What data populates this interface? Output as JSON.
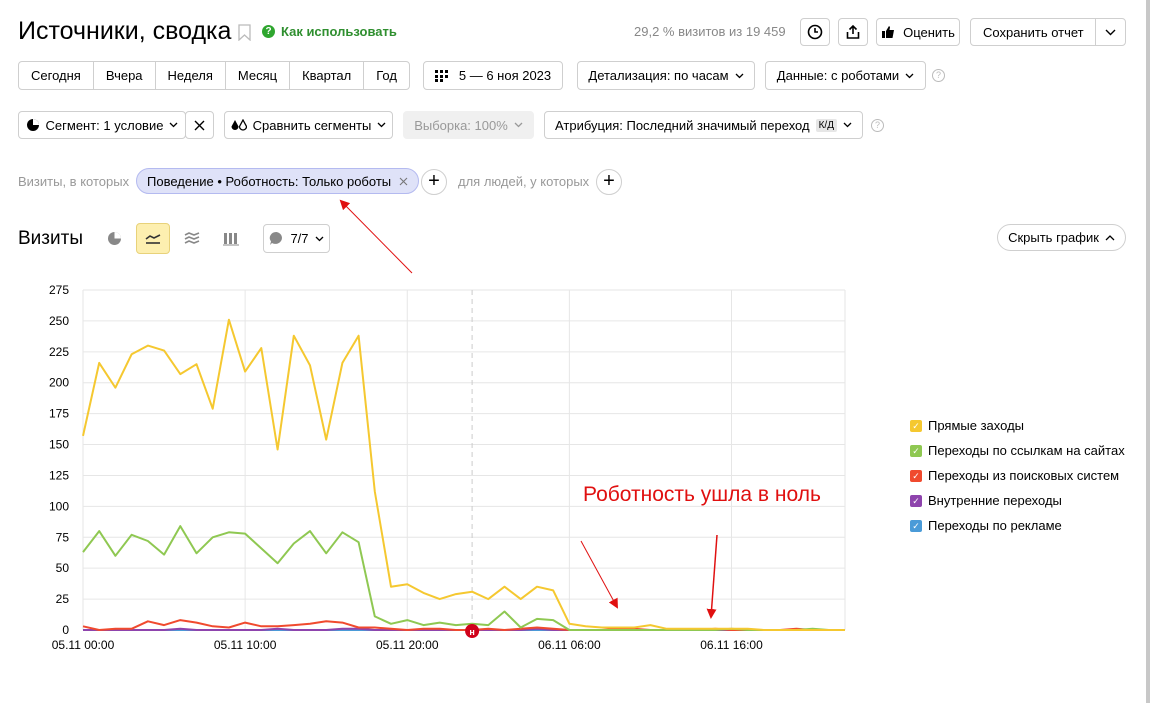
{
  "header": {
    "title": "Источники, сводка",
    "how_to_use": "Как использовать",
    "visits_info": "29,2 % визитов из 19 459",
    "rate_label": "Оценить",
    "save_report_label": "Сохранить отчет"
  },
  "periods": [
    "Сегодня",
    "Вчера",
    "Неделя",
    "Месяц",
    "Квартал",
    "Год"
  ],
  "date_range": "5 — 6 ноя 2023",
  "detail": "Детализация: по часам",
  "data_mode": "Данные: с роботами",
  "segment": "Сегмент: 1 условие",
  "compare": "Сравнить сегменты",
  "sample": "Выборка: 100%",
  "attribution": "Атрибуция: Последний значимый переход",
  "attribution_badge": "К/Д",
  "filter": {
    "prefix": "Визиты, в которых",
    "chip": "Поведение • Роботность: Только роботы",
    "people": "для людей, у которых"
  },
  "visits_section": {
    "title": "Визиты",
    "metrics_count": "7/7",
    "hide_chart": "Скрыть график"
  },
  "annotation": "Роботность ушла в ноль",
  "marker_label": "н",
  "chart_data": {
    "type": "line",
    "ylim": [
      0,
      275
    ],
    "yticks": [
      0,
      25,
      50,
      75,
      100,
      125,
      150,
      175,
      200,
      225,
      250,
      275
    ],
    "xtick_labels": [
      "05.11 00:00",
      "05.11 10:00",
      "05.11 20:00",
      "06.11 06:00",
      "06.11 16:00"
    ],
    "xtick_hours": [
      0,
      10,
      20,
      30,
      40
    ],
    "grid": true,
    "legend_position": "right",
    "hours": [
      0,
      1,
      2,
      3,
      4,
      5,
      6,
      7,
      8,
      9,
      10,
      11,
      12,
      13,
      14,
      15,
      16,
      17,
      18,
      19,
      20,
      21,
      22,
      23,
      24,
      25,
      26,
      27,
      28,
      29,
      30,
      31,
      32,
      33,
      34,
      35,
      36,
      37,
      38,
      39,
      40,
      41,
      42,
      43,
      44,
      45,
      46,
      47
    ],
    "series": [
      {
        "name": "Прямые заходы",
        "color": "#f5c830",
        "values": [
          157,
          216,
          196,
          223,
          230,
          226,
          207,
          215,
          179,
          251,
          209,
          228,
          146,
          238,
          214,
          154,
          216,
          238,
          112,
          35,
          37,
          30,
          25,
          29,
          31,
          25,
          35,
          25,
          35,
          32,
          5,
          3,
          2,
          2,
          2,
          4,
          1,
          1,
          1,
          1,
          1,
          1,
          0,
          0,
          0,
          0,
          0,
          0
        ]
      },
      {
        "name": "Переходы по ссылкам на сайтах",
        "color": "#8fc852",
        "values": [
          63,
          80,
          60,
          77,
          72,
          61,
          84,
          62,
          75,
          79,
          78,
          66,
          54,
          70,
          80,
          62,
          79,
          71,
          11,
          5,
          8,
          4,
          6,
          4,
          5,
          4,
          15,
          2,
          9,
          8,
          0,
          0,
          0,
          0,
          0,
          0,
          0,
          0,
          0,
          0,
          1,
          0,
          0,
          0,
          0,
          1,
          0,
          0
        ]
      },
      {
        "name": "Переходы из поисковых систем",
        "color": "#f04a2e",
        "values": [
          3,
          0,
          1,
          1,
          7,
          4,
          8,
          6,
          3,
          2,
          6,
          3,
          3,
          4,
          5,
          7,
          6,
          2,
          2,
          1,
          0,
          1,
          1,
          0,
          0,
          1,
          0,
          1,
          2,
          1,
          0,
          0,
          0,
          1,
          1,
          0,
          0,
          0,
          0,
          1,
          0,
          0,
          0,
          0,
          1,
          0,
          0,
          0
        ]
      },
      {
        "name": "Внутренние переходы",
        "color": "#8e44ad",
        "values": [
          0,
          0,
          0,
          0,
          0,
          0,
          1,
          0,
          0,
          0,
          0,
          0,
          1,
          0,
          0,
          0,
          1,
          1,
          0,
          0,
          0,
          0,
          0,
          0,
          0,
          0,
          0,
          0,
          1,
          0,
          0,
          0,
          0,
          0,
          0,
          0,
          0,
          0,
          0,
          0,
          0,
          0,
          0,
          0,
          0,
          0,
          0,
          0
        ]
      },
      {
        "name": "Переходы по рекламе",
        "color": "#4a9bd8",
        "values": [
          0,
          0,
          0,
          0,
          0,
          0,
          0,
          0,
          0,
          0,
          0,
          0,
          0,
          0,
          0,
          0,
          0,
          0,
          0,
          0,
          0,
          0,
          0,
          0,
          0,
          0,
          0,
          0,
          0,
          0,
          0,
          0,
          0,
          0,
          0,
          0,
          0,
          0,
          0,
          0,
          0,
          0,
          0,
          0,
          0,
          0,
          0,
          0
        ]
      }
    ]
  }
}
